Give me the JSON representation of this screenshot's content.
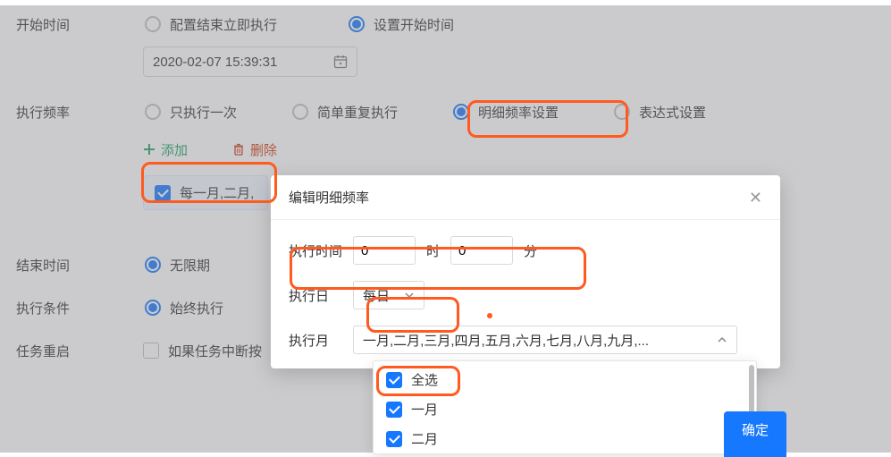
{
  "form": {
    "start_time": {
      "label": "开始时间",
      "option_immediate": "配置结束立即执行",
      "option_set": "设置开始时间",
      "datetime_value": "2020-02-07 15:39:31"
    },
    "frequency": {
      "label": "执行频率",
      "option_once": "只执行一次",
      "option_simple": "简单重复执行",
      "option_detail": "明细频率设置",
      "option_expr": "表达式设置",
      "add_label": "添加",
      "delete_label": "删除",
      "selected_summary": "每一月,二月,"
    },
    "end_time": {
      "label": "结束时间",
      "option_unlimited": "无限期"
    },
    "condition": {
      "label": "执行条件",
      "option_always": "始终执行"
    },
    "restart": {
      "label": "任务重启",
      "checkbox_label": "如果任务中断按"
    }
  },
  "modal": {
    "title": "编辑明细频率",
    "exec_time_label": "执行时间",
    "hour_value": "0",
    "hour_unit": "时",
    "minute_value": "0",
    "minute_unit": "分",
    "exec_day_label": "执行日",
    "exec_day_value": "每日",
    "exec_month_label": "执行月",
    "exec_month_value": "一月,二月,三月,四月,五月,六月,七月,八月,九月,...",
    "dropdown": {
      "select_all": "全选",
      "m1": "一月",
      "m2": "二月"
    },
    "ok": "确定"
  }
}
